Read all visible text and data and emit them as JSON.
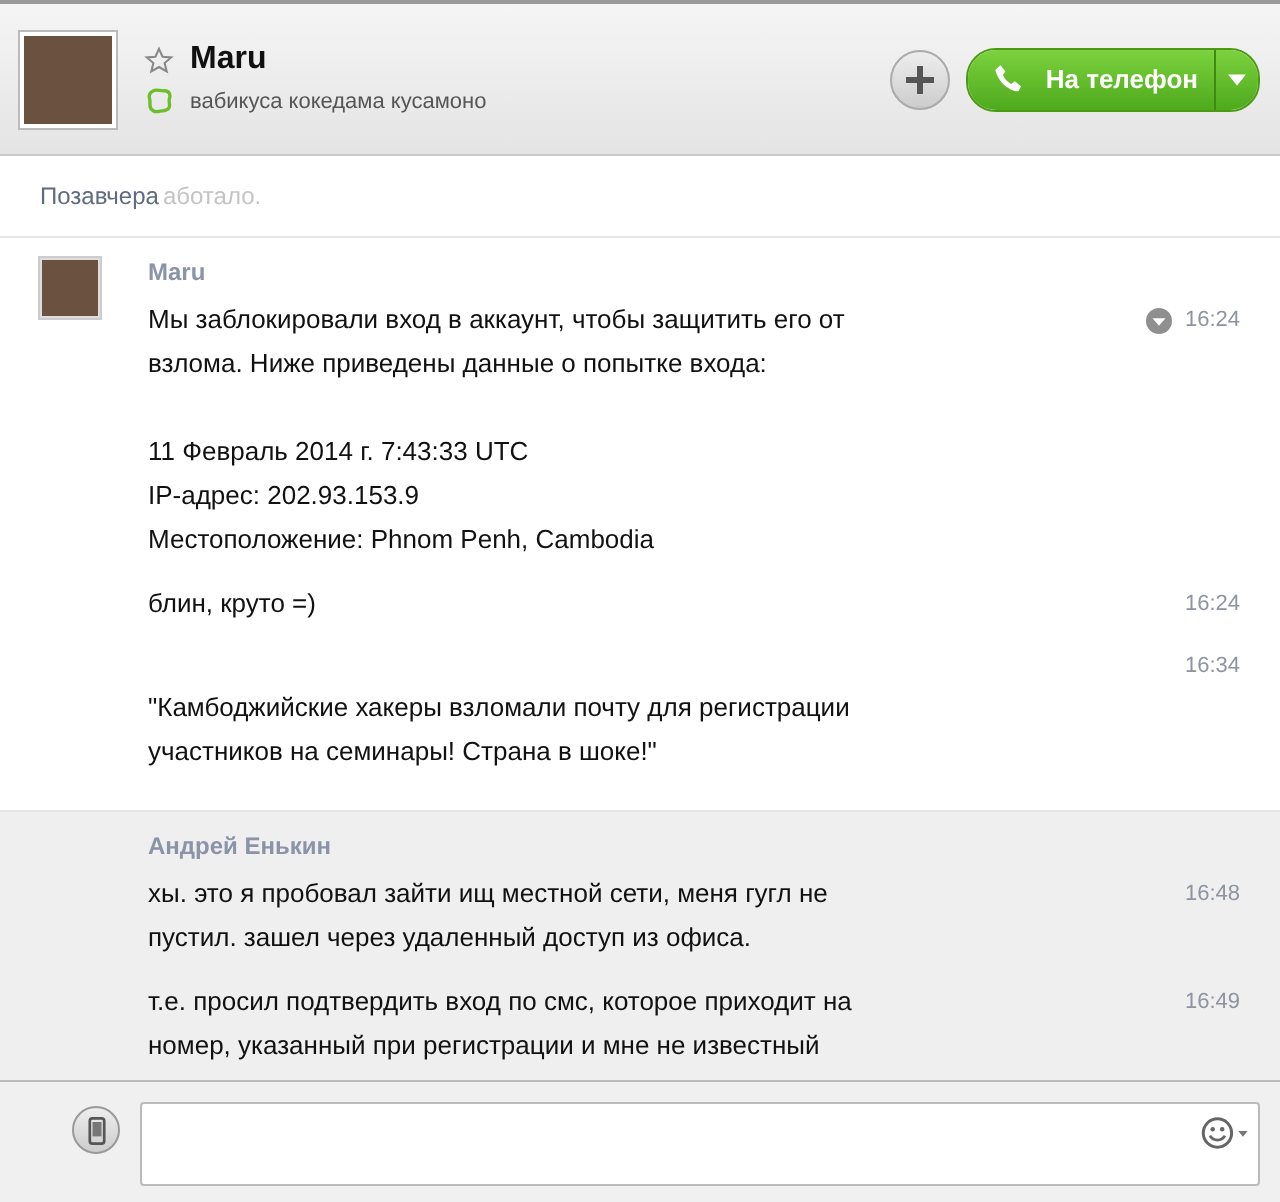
{
  "header": {
    "name": "Maru",
    "favorite": false,
    "mood": "вабикуса кокедама кусамоно",
    "call_button": "На телефон"
  },
  "faded_text": "аботало.",
  "day_label": "Позавчера",
  "groups": [
    {
      "sender": "Maru",
      "has_avatar": true,
      "shaded": false,
      "messages": [
        {
          "kind": "inline",
          "text": "Мы заблокировали вход в аккаунт, чтобы защитить его от взлома. Ниже приведены данные о попытке входа:\n\n11 Февраль 2014 г. 7:43:33 UTC\nIP-адрес: 202.93.153.9\nМестоположение: Phnom Penh, Cambodia",
          "time": "16:24",
          "menu": true
        },
        {
          "kind": "inline",
          "text": "блин, круто =)",
          "time": "16:24",
          "menu": false
        },
        {
          "kind": "time_above",
          "text": "\"Камбоджийские хакеры взломали почту для регистрации участников на семинары! Страна в шоке!\"",
          "time": "16:34",
          "menu": false
        }
      ]
    },
    {
      "sender": "Андрей Енькин",
      "has_avatar": false,
      "shaded": true,
      "messages": [
        {
          "kind": "inline",
          "text": "хы. это я пробовал зайти ищ местной сети, меня гугл не пустил. зашел через удаленный доступ из офиса.",
          "time": "16:48",
          "menu": false
        },
        {
          "kind": "inline",
          "text": "т.е. просил подтвердить вход по смс, которое приходит на номер, указанный при регистрации и мне не известный",
          "time": "16:49",
          "menu": false
        }
      ]
    }
  ]
}
